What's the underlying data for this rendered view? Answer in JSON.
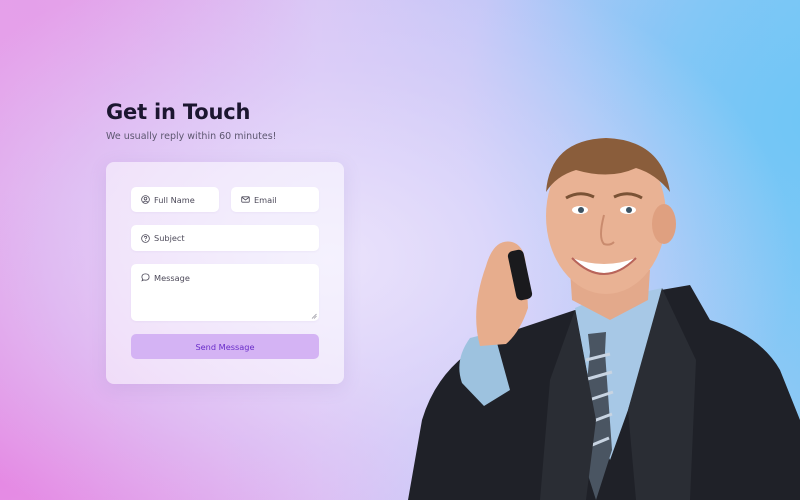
{
  "contact": {
    "title": "Get in Touch",
    "subtitle": "We usually reply within 60 minutes!"
  },
  "form": {
    "full_name": {
      "placeholder": "Full Name",
      "icon": "user-circle-icon"
    },
    "email": {
      "placeholder": "Email",
      "icon": "envelope-icon"
    },
    "subject": {
      "placeholder": "Subject",
      "icon": "question-circle-icon"
    },
    "message": {
      "placeholder": "Message",
      "icon": "speech-bubble-icon"
    },
    "submit_label": "Send Message"
  },
  "colors": {
    "button_bg": "#d4b3f4",
    "button_text": "#6a2ec9",
    "title": "#1c1630"
  }
}
